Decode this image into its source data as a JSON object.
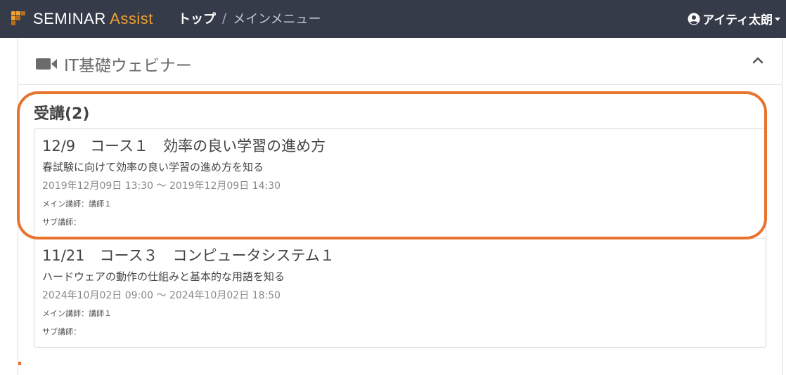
{
  "app": {
    "brand_main": "SEMINAR",
    "brand_accent": "Assist",
    "accent_color": "#f0a030",
    "navbar_color": "#353b48"
  },
  "breadcrumb": {
    "top": "トップ",
    "separator": "/",
    "current": "メインメニュー"
  },
  "user": {
    "name": "アイティ太朗",
    "icon": "user-circle-icon"
  },
  "card": {
    "title": "IT基礎ウェビナー",
    "title_icon": "video-camera-icon",
    "collapse_icon": "chevron-up-icon"
  },
  "section": {
    "title": "受講(2)"
  },
  "courses": [
    {
      "title": "12/9　コース１　効率の良い学習の進め方",
      "description": "春試験に向けて効率の良い学習の進め方を知る",
      "time": "2019年12月09日 13:30 ～ 2019年12月09日 14:30",
      "main_lecturer": "メイン講師：講師１",
      "sub_lecturer": "サブ講師："
    },
    {
      "title": "11/21　コース３　コンピュータシステム１",
      "description": "ハードウェアの動作の仕組みと基本的な用語を知る",
      "time": "2024年10月02日 09:00 ～ 2024年10月02日 18:50",
      "main_lecturer": "メイン講師：講師１",
      "sub_lecturer": "サブ講師："
    }
  ],
  "annotation": {
    "highlight_color": "#e8732d"
  }
}
